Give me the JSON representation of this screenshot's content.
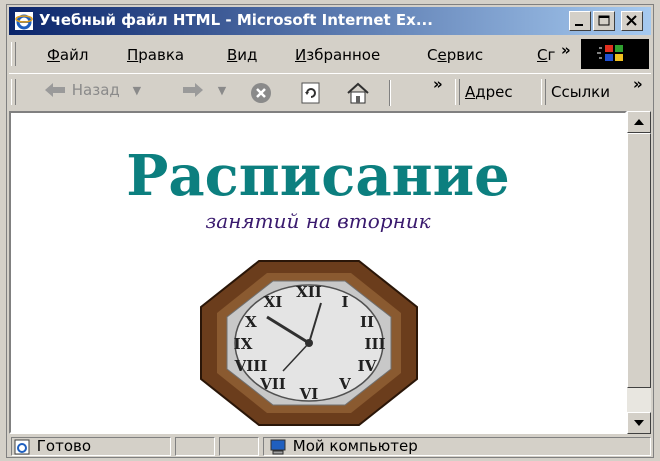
{
  "window": {
    "title": "Учебный файл HTML - Microsoft Internet Ex..."
  },
  "controls": {
    "minimize": "_",
    "maximize": "□",
    "close": "×"
  },
  "menu": {
    "items": [
      {
        "label": "Файл",
        "accel": "Ф",
        "rest": "айл"
      },
      {
        "label": "Правка",
        "accel": "П",
        "rest": "равка"
      },
      {
        "label": "Вид",
        "accel": "В",
        "rest": "ид"
      },
      {
        "label": "Избранное",
        "accel": "И",
        "rest": "збранное"
      },
      {
        "label": "Сервис",
        "accel": "е",
        "pre": "С",
        "rest": "рвис"
      },
      {
        "label": "Сг",
        "accel": "С",
        "rest": "г"
      }
    ],
    "overflow": "»"
  },
  "toolbar": {
    "back_label": "Назад",
    "overflow": "»",
    "address_label": "Адрес",
    "links_label": "Ссылки",
    "links_overflow": "»"
  },
  "page": {
    "heading": "Расписание",
    "subheading": "занятий на вторник",
    "heading_color": "#0c7f7f",
    "subheading_color": "#3a1a6e"
  },
  "status": {
    "ready": "Готово",
    "zone": "Мой компьютер"
  },
  "icons": [
    "ie-icon",
    "windows-logo-icon",
    "back-arrow-icon",
    "forward-arrow-icon",
    "stop-icon",
    "refresh-icon",
    "home-icon",
    "computer-icon",
    "clock-image"
  ]
}
